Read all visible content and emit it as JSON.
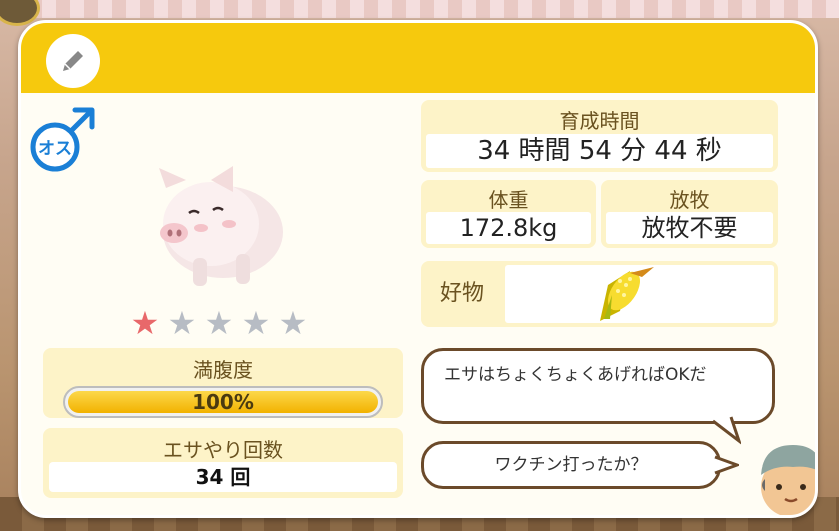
{
  "header": {
    "edit_icon": "pencil-icon"
  },
  "animal": {
    "gender_label": "オス",
    "gender_icon": "male-symbol-icon",
    "rating": {
      "filled": 1,
      "total": 5
    }
  },
  "stats": {
    "fullness": {
      "label": "満腹度",
      "value_text": "100%",
      "fraction": 1.0
    },
    "feed_count": {
      "label": "エサやり回数",
      "value": "34 回"
    }
  },
  "info": {
    "raise_time": {
      "label": "育成時間",
      "value": "34 時間 54 分 44 秒"
    },
    "weight": {
      "label": "体重",
      "value": "172.8kg"
    },
    "grazing": {
      "label": "放牧",
      "value": "放牧不要"
    },
    "favorite": {
      "label": "好物",
      "item_icon": "corn-icon"
    }
  },
  "speech": {
    "bubble1": "エサはちょくちょくあげればOKだ",
    "bubble2": "ワクチン打ったか？"
  },
  "colors": {
    "header": "#f6c90d",
    "accent_yellow": "#fdf3c8",
    "star_filled": "#e8686a",
    "star_empty": "#b7bcc4"
  }
}
